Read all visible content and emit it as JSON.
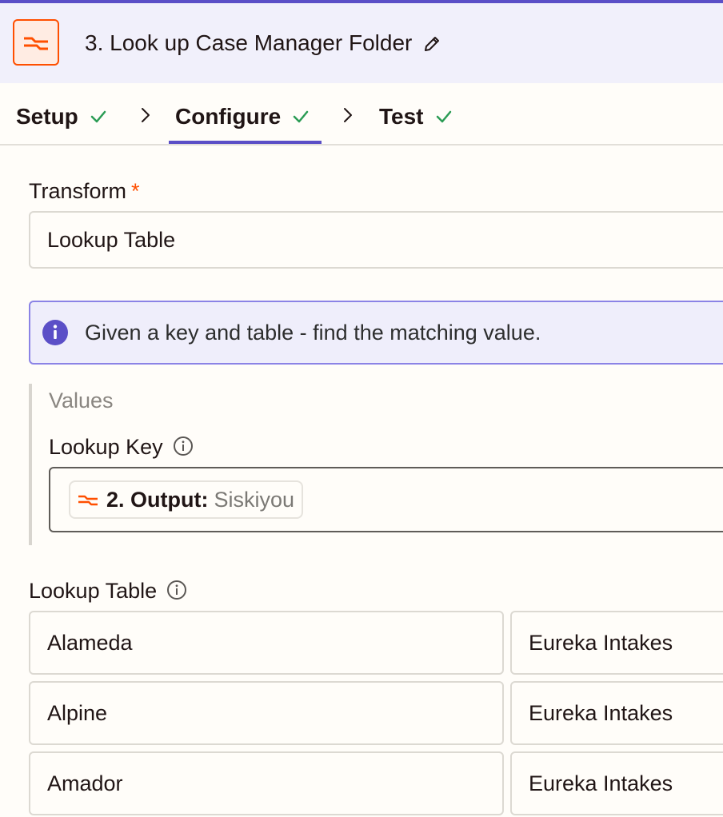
{
  "header": {
    "title": "3. Look up Case Manager Folder"
  },
  "tabs": [
    {
      "label": "Setup"
    },
    {
      "label": "Configure"
    },
    {
      "label": "Test"
    }
  ],
  "transform": {
    "label": "Transform",
    "required_mark": "*",
    "value": "Lookup Table"
  },
  "alert": {
    "text": "Given a key and table - find the matching value."
  },
  "values": {
    "heading": "Values",
    "lookup_key": {
      "label": "Lookup Key",
      "pill_label": "2. Output:",
      "pill_value": "Siskiyou"
    }
  },
  "lookup_table": {
    "label": "Lookup Table",
    "rows": [
      {
        "key": "Alameda",
        "value": "Eureka Intakes"
      },
      {
        "key": "Alpine",
        "value": "Eureka Intakes"
      },
      {
        "key": "Amador",
        "value": "Eureka Intakes"
      }
    ]
  },
  "colors": {
    "accent": "#5b4fc7",
    "brand_orange": "#ff4f00",
    "success_green": "#2b9c55"
  }
}
